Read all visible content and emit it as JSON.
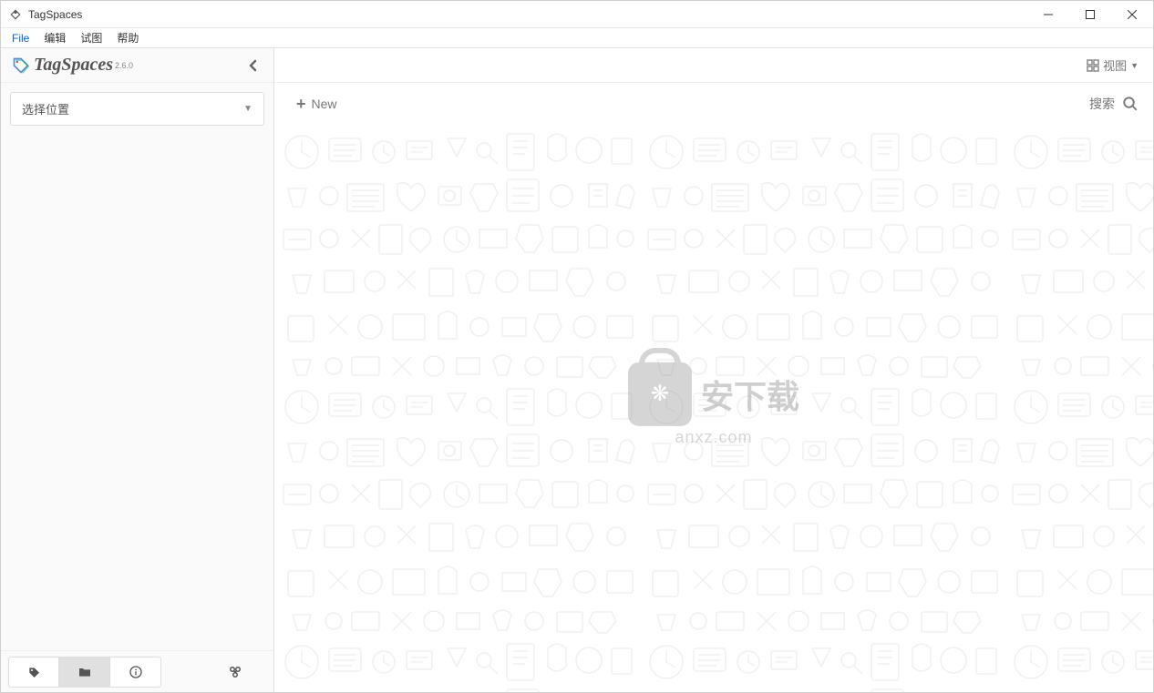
{
  "titlebar": {
    "title": "TagSpaces"
  },
  "menubar": {
    "items": [
      "File",
      "编辑",
      "试图",
      "帮助"
    ]
  },
  "sidebar": {
    "logo_text": "TagSpaces",
    "version": "2.6.0",
    "location_label": "选择位置"
  },
  "content": {
    "view_label": "视图",
    "new_label": "New",
    "search_label": "搜索"
  },
  "watermark": {
    "text1": "安下载",
    "text2": "anxz.com"
  }
}
